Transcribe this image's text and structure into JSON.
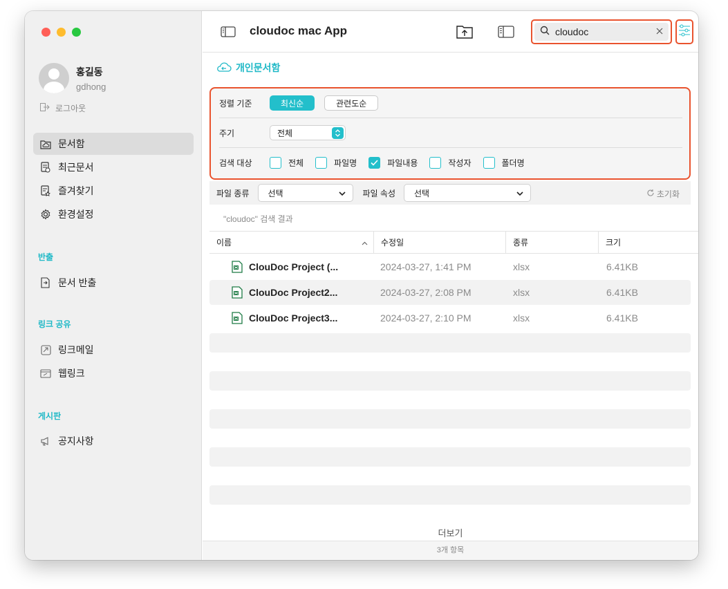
{
  "colors": {
    "accent": "#20b9c7",
    "highlight_border": "#e9532e",
    "close": "#ff5f57",
    "minimize": "#febc2e",
    "zoom": "#28c840"
  },
  "app": {
    "title": "cloudoc mac App"
  },
  "user": {
    "name": "홍길동",
    "id": "gdhong",
    "logout": "로그아웃"
  },
  "sidebar": {
    "items": [
      {
        "label": "문서함",
        "icon": "cloud-folder-icon"
      },
      {
        "label": "최근문서",
        "icon": "recent-doc-icon"
      },
      {
        "label": "즐겨찾기",
        "icon": "star-doc-icon"
      },
      {
        "label": "환경설정",
        "icon": "gear-icon"
      }
    ],
    "export_title": "반출",
    "export_items": [
      {
        "label": "문서 반출",
        "icon": "export-doc-icon"
      }
    ],
    "link_title": "링크 공유",
    "link_items": [
      {
        "label": "링크메일",
        "icon": "link-mail-icon"
      },
      {
        "label": "웹링크",
        "icon": "web-link-icon"
      }
    ],
    "board_title": "게시판",
    "board_items": [
      {
        "label": "공지사항",
        "icon": "megaphone-icon"
      }
    ]
  },
  "search": {
    "value": "cloudoc"
  },
  "breadcrumb": {
    "label": "개인문서함"
  },
  "filters": {
    "sort_label": "정렬 기준",
    "sort_options": [
      "최신순",
      "관련도순"
    ],
    "sort_selected": "최신순",
    "period_label": "주기",
    "period_value": "전체",
    "target_label": "검색 대상",
    "targets": [
      {
        "label": "전체",
        "checked": false
      },
      {
        "label": "파일명",
        "checked": false
      },
      {
        "label": "파일내용",
        "checked": true
      },
      {
        "label": "작성자",
        "checked": false
      },
      {
        "label": "폴더명",
        "checked": false
      }
    ]
  },
  "attributes": {
    "type_label": "파일 종류",
    "type_value": "선택",
    "prop_label": "파일 속성",
    "prop_value": "선택",
    "reset": "초기화"
  },
  "results": {
    "label": "\"cloudoc\" 검색 결과",
    "columns": [
      "이름",
      "수정일",
      "종류",
      "크기"
    ],
    "rows": [
      {
        "name": "ClouDoc Project (...",
        "date": "2024-03-27, 1:41 PM",
        "type": "xlsx",
        "size": "6.41KB"
      },
      {
        "name": "ClouDoc Project2...",
        "date": "2024-03-27, 2:08 PM",
        "type": "xlsx",
        "size": "6.41KB"
      },
      {
        "name": "ClouDoc Project3...",
        "date": "2024-03-27, 2:10 PM",
        "type": "xlsx",
        "size": "6.41KB"
      }
    ],
    "more": "더보기",
    "count": "3개 항목"
  }
}
